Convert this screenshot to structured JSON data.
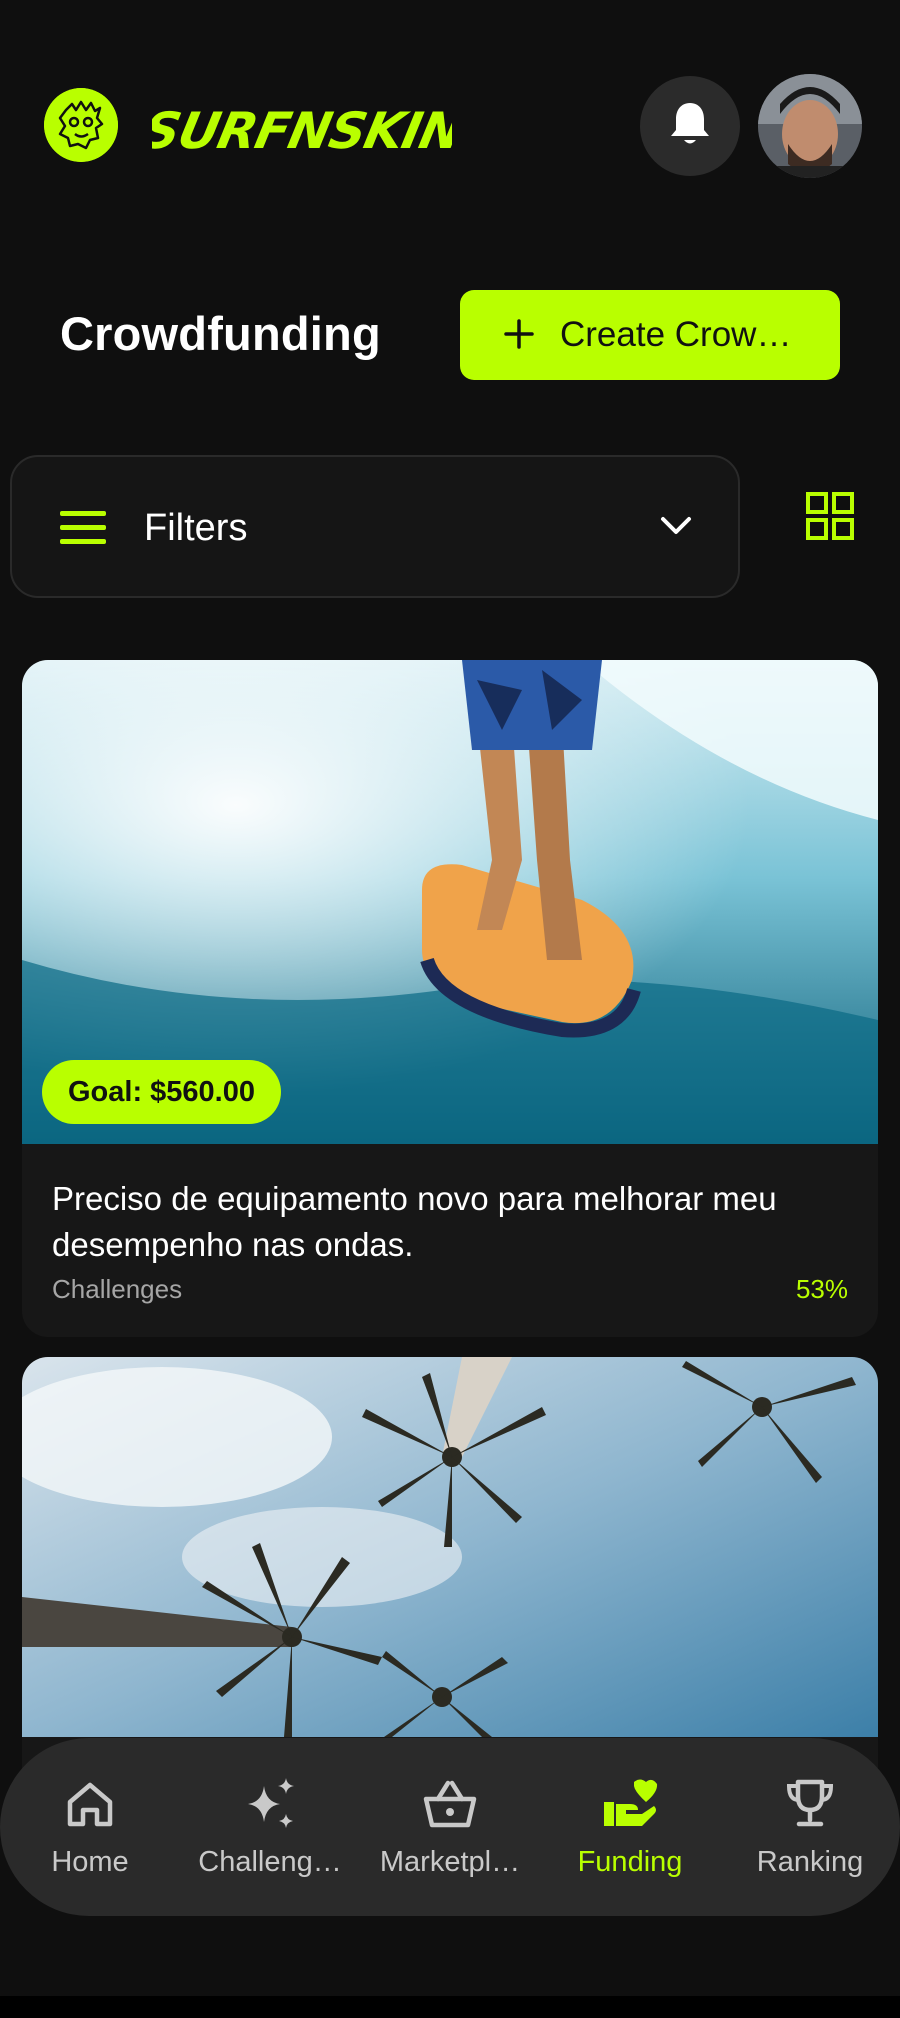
{
  "header": {
    "brand": "SURFNSKIN",
    "notifications_icon": "bell-icon",
    "avatar_alt": "user avatar"
  },
  "page": {
    "title": "Crowdfunding",
    "create_button": "Create Crow…"
  },
  "filters": {
    "label": "Filters",
    "menu_icon": "menu-icon",
    "expand_icon": "chevron-down-icon",
    "view_toggle_icon": "grid-view-icon"
  },
  "cards": [
    {
      "goal": "Goal: $560.00",
      "title": "Preciso de equipamento novo para melhorar meu desempenho nas ondas.",
      "category": "Challenges",
      "progress": "53%"
    },
    {
      "goal": "",
      "title": "",
      "category": "",
      "progress": ""
    }
  ],
  "bottom_nav": {
    "items": [
      {
        "label": "Home",
        "icon": "home-icon"
      },
      {
        "label": "Challeng…",
        "icon": "sparkles-icon"
      },
      {
        "label": "Marketpl…",
        "icon": "basket-icon"
      },
      {
        "label": "Funding",
        "icon": "hand-heart-icon"
      },
      {
        "label": "Ranking",
        "icon": "trophy-icon"
      }
    ],
    "active": "Funding"
  },
  "colors": {
    "accent": "#b9ff00",
    "background": "#0f0f0f",
    "surface": "#171717",
    "muted_text": "#a6a6a6"
  }
}
